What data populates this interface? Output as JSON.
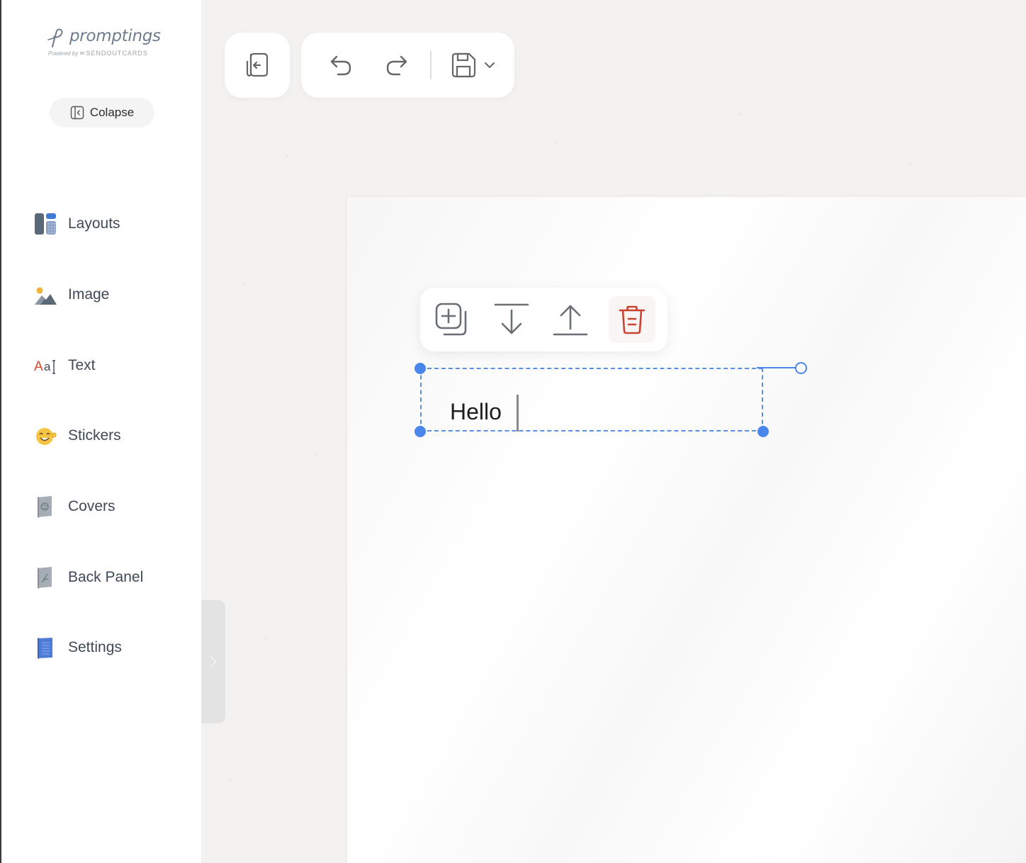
{
  "brand": {
    "name": "promptings",
    "powered_by": "Powered by",
    "partner": "SENDOUTCARDS"
  },
  "sidebar": {
    "collapse_label": "Colapse",
    "items": [
      {
        "label": "Layouts",
        "icon": "layouts-icon"
      },
      {
        "label": "Image",
        "icon": "image-icon"
      },
      {
        "label": "Text",
        "icon": "text-icon"
      },
      {
        "label": "Stickers",
        "icon": "stickers-icon"
      },
      {
        "label": "Covers",
        "icon": "covers-icon"
      },
      {
        "label": "Back Panel",
        "icon": "back-panel-icon"
      },
      {
        "label": "Settings",
        "icon": "settings-icon"
      }
    ]
  },
  "toolbar": {
    "exit_icon": "exit-editor-icon",
    "undo_icon": "undo-icon",
    "redo_icon": "redo-icon",
    "save_icon": "save-icon",
    "save_menu_icon": "chevron-down-icon"
  },
  "element_toolbar": {
    "duplicate_icon": "duplicate-icon",
    "send_backward_icon": "send-backward-icon",
    "bring_forward_icon": "bring-forward-icon",
    "delete_icon": "trash-icon"
  },
  "canvas": {
    "text_value": "Hello"
  },
  "colors": {
    "accent": "#4a86ec",
    "delete": "#c9432e",
    "sidebar_bg": "#ffffff",
    "workspace_bg": "#f3f2f1"
  }
}
